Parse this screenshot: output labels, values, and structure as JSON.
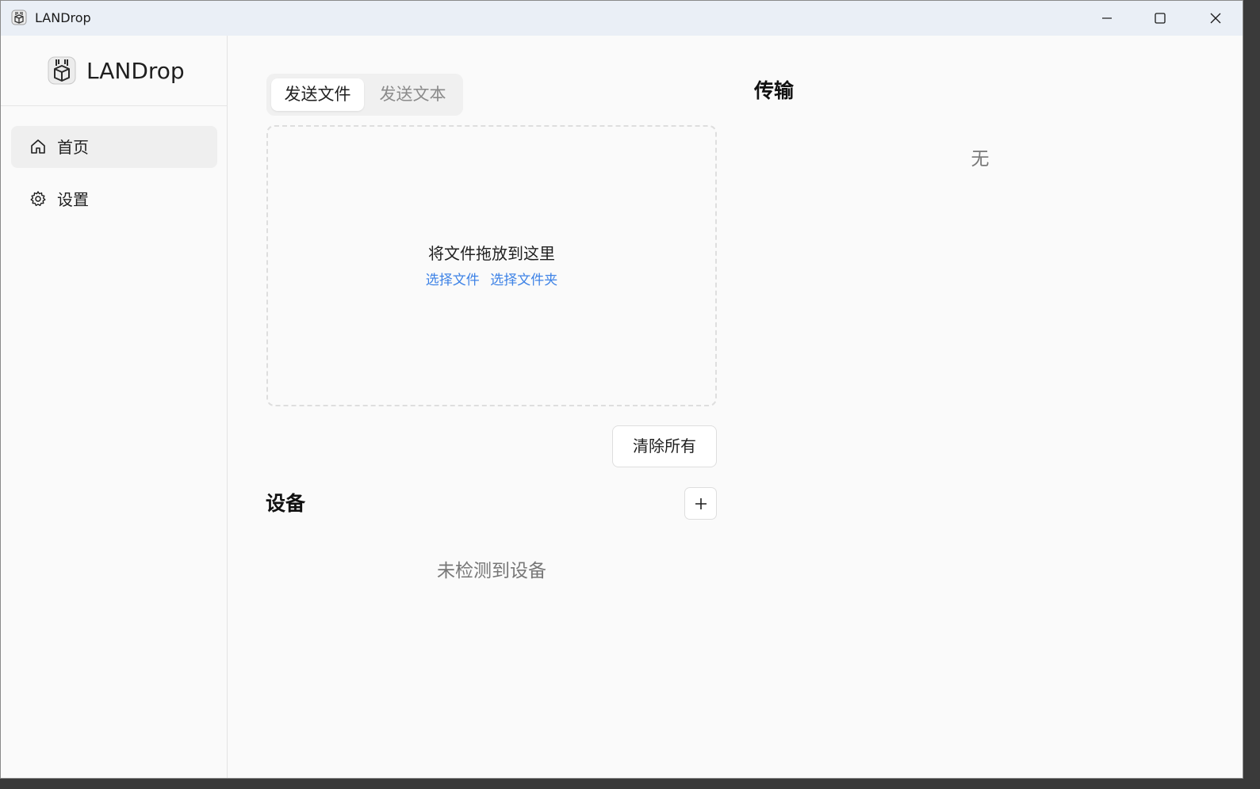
{
  "window": {
    "title": "LANDrop"
  },
  "sidebar": {
    "brand_name": "LANDrop",
    "items": [
      {
        "label": "首页",
        "icon": "home-icon",
        "active": true
      },
      {
        "label": "设置",
        "icon": "gear-icon",
        "active": false
      }
    ]
  },
  "send": {
    "tabs": [
      {
        "label": "发送文件",
        "active": true
      },
      {
        "label": "发送文本",
        "active": false
      }
    ],
    "dropzone": {
      "title": "将文件拖放到这里",
      "select_files": "选择文件",
      "select_folder": "选择文件夹"
    },
    "clear_all_label": "清除所有"
  },
  "devices": {
    "title": "设备",
    "add_label": "+",
    "empty_text": "未检测到设备"
  },
  "transfers": {
    "title": "传输",
    "empty_text": "无"
  },
  "colors": {
    "accent_link": "#3d82e6",
    "titlebar_bg": "#eaeff6",
    "content_bg": "#fafafa"
  }
}
